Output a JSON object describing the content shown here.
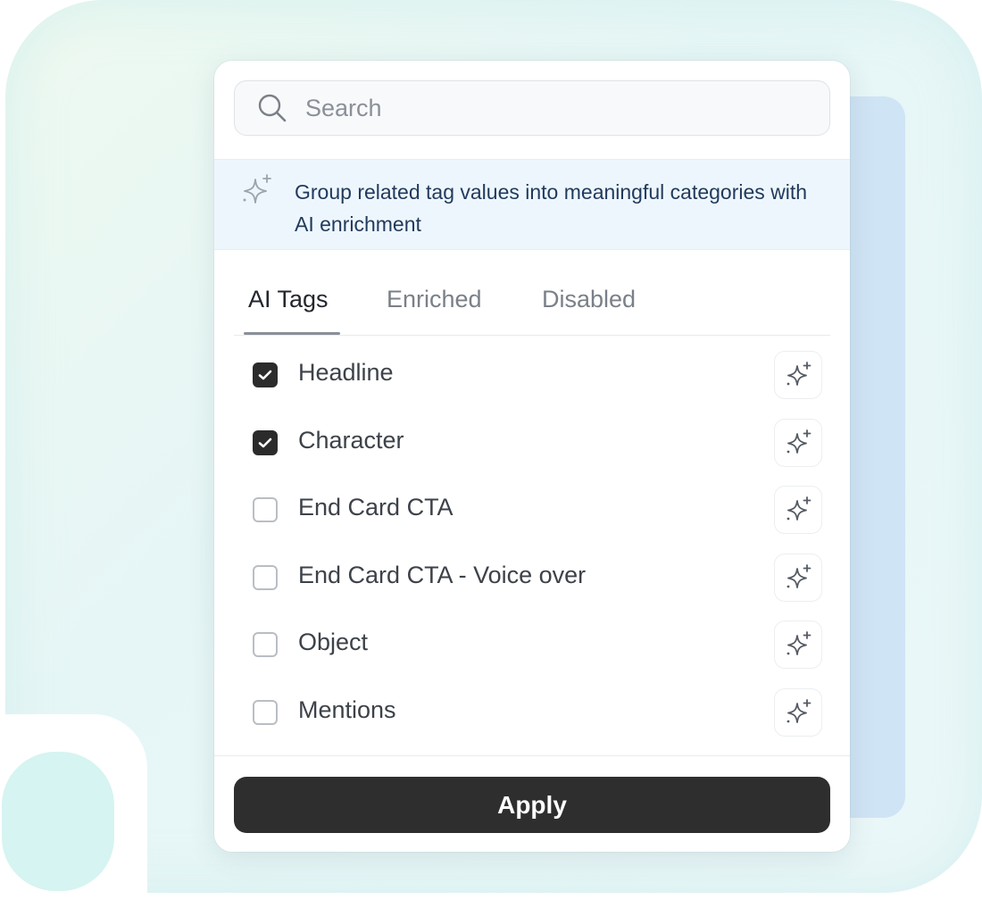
{
  "search": {
    "placeholder": "Search",
    "value": ""
  },
  "banner": {
    "text": "Group related tag values into meaningful categories with AI enrichment",
    "icon": "sparkle-icon"
  },
  "tabs": [
    {
      "label": "AI Tags",
      "active": true
    },
    {
      "label": "Enriched",
      "active": false
    },
    {
      "label": "Disabled",
      "active": false
    }
  ],
  "tags": [
    {
      "label": "Headline",
      "checked": true
    },
    {
      "label": "Character",
      "checked": true
    },
    {
      "label": "End Card CTA",
      "checked": false
    },
    {
      "label": "End Card CTA - Voice over",
      "checked": false
    },
    {
      "label": "Object",
      "checked": false
    },
    {
      "label": "Mentions",
      "checked": false
    }
  ],
  "footer": {
    "apply_label": "Apply"
  },
  "colors": {
    "primary": "#2e2e2e",
    "banner_bg": "#eef6fd",
    "banner_text": "#1f3a5c"
  }
}
